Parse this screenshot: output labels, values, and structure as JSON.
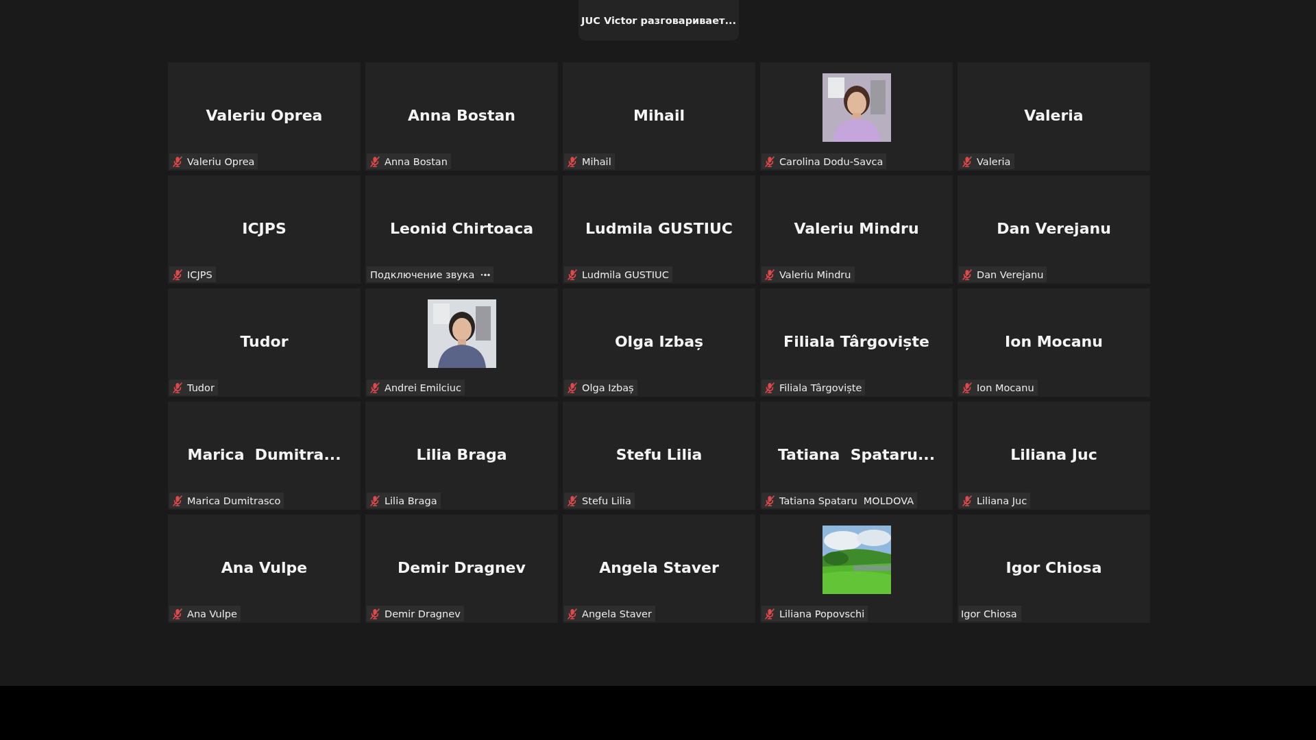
{
  "speaker_banner": "JUC Victor разговаривает...",
  "tiles": [
    {
      "kind": "name",
      "display_name": "Valeriu Oprea",
      "label": "Valeriu Oprea",
      "muted": true,
      "connecting": false
    },
    {
      "kind": "name",
      "display_name": "Anna Bostan",
      "label": "Anna Bostan",
      "muted": true,
      "connecting": false
    },
    {
      "kind": "name",
      "display_name": "Mihail",
      "label": "Mihail",
      "muted": true,
      "connecting": false
    },
    {
      "kind": "picture",
      "label": "Carolina Dodu-Savca",
      "muted": true,
      "connecting": false
    },
    {
      "kind": "name",
      "display_name": "Valeria",
      "label": "Valeria",
      "muted": true,
      "connecting": false
    },
    {
      "kind": "name",
      "display_name": "ICJPS",
      "label": "ICJPS",
      "muted": true,
      "connecting": false
    },
    {
      "kind": "name",
      "display_name": "Leonid Chirtoaca",
      "label": "Подключение звука",
      "muted": false,
      "connecting": true
    },
    {
      "kind": "name",
      "display_name": "Ludmila GUSTIUC",
      "label": "Ludmila GUSTIUC",
      "muted": true,
      "connecting": false
    },
    {
      "kind": "name",
      "display_name": "Valeriu Mindru",
      "label": "Valeriu Mindru",
      "muted": true,
      "connecting": false
    },
    {
      "kind": "name",
      "display_name": "Dan Verejanu",
      "label": "Dan Verejanu",
      "muted": true,
      "connecting": false
    },
    {
      "kind": "name",
      "display_name": "Tudor",
      "label": "Tudor",
      "muted": true,
      "connecting": false
    },
    {
      "kind": "picture",
      "label": "Andrei Emilciuc",
      "muted": true,
      "connecting": false
    },
    {
      "kind": "name",
      "display_name": "Olga Izbaș",
      "label": "Olga Izbaș",
      "muted": true,
      "connecting": false
    },
    {
      "kind": "name",
      "display_name": "Filiala Târgoviște",
      "label": "Filiala Târgoviște",
      "muted": true,
      "connecting": false
    },
    {
      "kind": "name",
      "display_name": "Ion Mocanu",
      "label": "Ion Mocanu",
      "muted": true,
      "connecting": false
    },
    {
      "kind": "name",
      "display_name": "Marica  Dumitra...",
      "label": "Marica Dumitrasco",
      "muted": true,
      "connecting": false
    },
    {
      "kind": "name",
      "display_name": "Lilia Braga",
      "label": "Lilia Braga",
      "muted": true,
      "connecting": false
    },
    {
      "kind": "name",
      "display_name": "Stefu Lilia",
      "label": "Stefu Lilia",
      "muted": true,
      "connecting": false
    },
    {
      "kind": "name",
      "display_name": "Tatiana  Spataru...",
      "label": "Tatiana Spataru  MOLDOVA",
      "muted": true,
      "connecting": false
    },
    {
      "kind": "name",
      "display_name": "Liliana Juc",
      "label": "Liliana Juc",
      "muted": true,
      "connecting": false
    },
    {
      "kind": "name",
      "display_name": "Ana Vulpe",
      "label": "Ana Vulpe",
      "muted": true,
      "connecting": false
    },
    {
      "kind": "name",
      "display_name": "Demir Dragnev",
      "label": "Demir Dragnev",
      "muted": true,
      "connecting": false
    },
    {
      "kind": "name",
      "display_name": "Angela Staver",
      "label": "Angela Staver",
      "muted": true,
      "connecting": false
    },
    {
      "kind": "picture",
      "label": "Liliana Popovschi",
      "muted": true,
      "connecting": false
    },
    {
      "kind": "name",
      "display_name": "Igor Chiosa",
      "label": "Igor Chiosa",
      "muted": false,
      "connecting": false
    }
  ]
}
